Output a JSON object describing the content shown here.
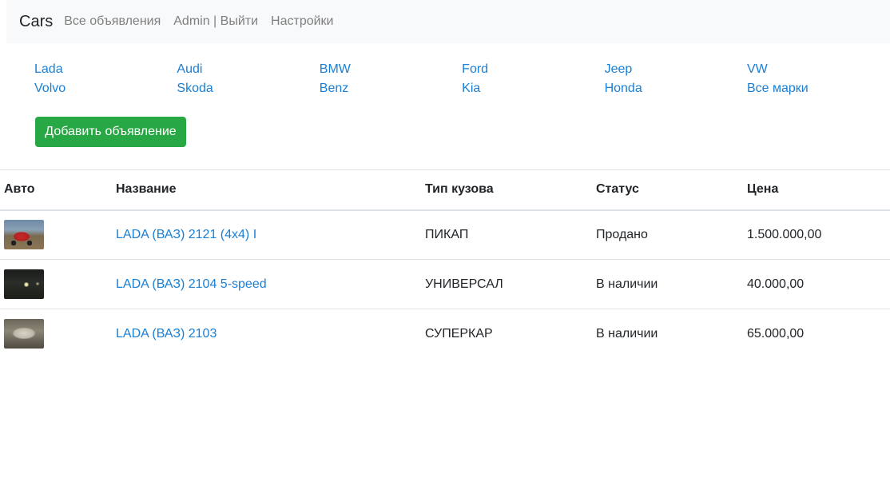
{
  "navbar": {
    "brand": "Cars",
    "links": [
      "Все объявления",
      "Admin | Выйти",
      "Настройки"
    ]
  },
  "brands": [
    "Lada",
    "Audi",
    "BMW",
    "Ford",
    "Jeep",
    "VW",
    "Volvo",
    "Skoda",
    "Benz",
    "Kia",
    "Honda",
    "Все марки"
  ],
  "add_button": "Добавить объявление",
  "table": {
    "headers": [
      "Авто",
      "Название",
      "Тип кузова",
      "Статус",
      "Цена"
    ],
    "rows": [
      {
        "name": "LADA (ВАЗ) 2121 (4x4) I",
        "body": "ПИКАП",
        "status": "Продано",
        "price": "1.500.000,00"
      },
      {
        "name": "LADA (ВАЗ) 2104 5-speed",
        "body": "УНИВЕРСАЛ",
        "status": "В наличии",
        "price": "40.000,00"
      },
      {
        "name": "LADA (ВАЗ) 2103",
        "body": "СУПЕРКАР",
        "status": "В наличии",
        "price": "65.000,00"
      }
    ]
  },
  "colors": {
    "link": "#1a7fd4",
    "button": "#28a745",
    "navbar_bg": "#f8f9fa",
    "nav_text": "#7f7f7f"
  }
}
